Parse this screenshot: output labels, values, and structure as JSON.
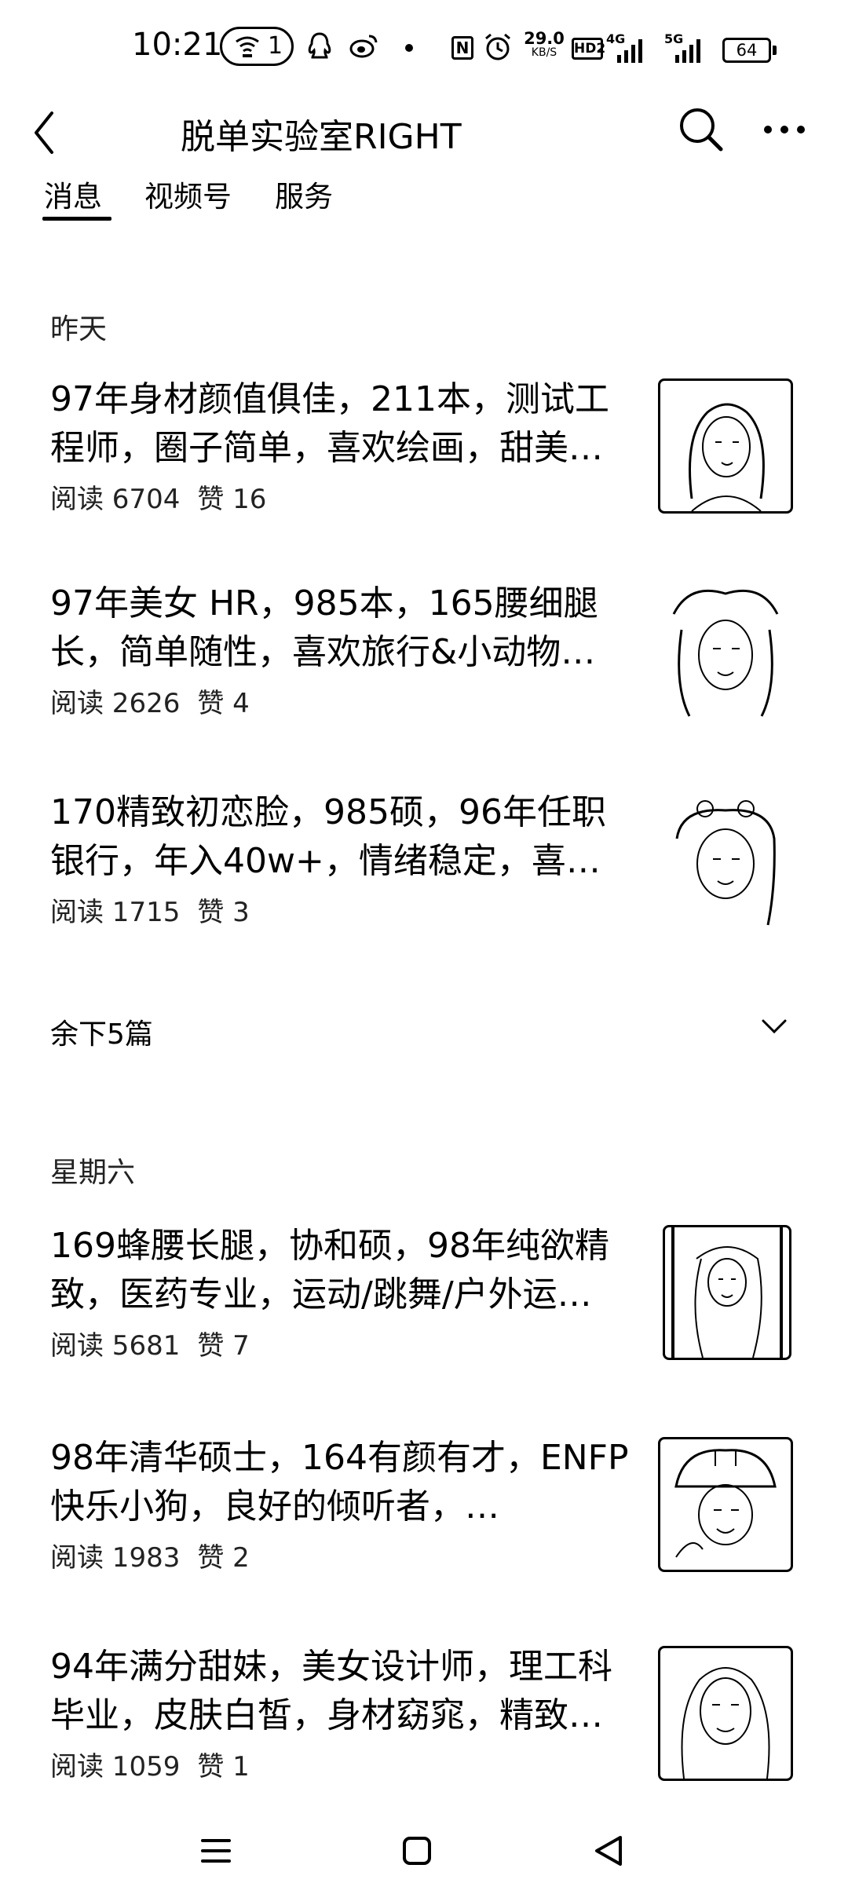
{
  "status_bar": {
    "time": "10:21",
    "pill_number": "1",
    "net_speed_value": "29.0",
    "net_speed_unit": "KB/S",
    "hd_label": "HD2",
    "signal1_label": "4G",
    "signal2_label": "5G",
    "battery": "64",
    "icons": [
      "wifi-hotspot-icon",
      "qq-icon",
      "weibo-icon",
      "nfc-icon",
      "alarm-icon",
      "hd-icon",
      "signal-icon",
      "battery-icon"
    ]
  },
  "header": {
    "title": "脱单实验室RIGHT",
    "back_icon": "chevron-left-icon",
    "search_icon": "search-icon",
    "more_icon": "more-horizontal-icon"
  },
  "tabs": [
    {
      "label": "消息",
      "active": true
    },
    {
      "label": "视频号",
      "active": false
    },
    {
      "label": "服务",
      "active": false
    }
  ],
  "sections": [
    {
      "date": "昨天",
      "articles": [
        {
          "title": "97年身材颜值俱佳，211本，测试工程师，圈子简单，喜欢绘画，甜美…",
          "reads": "阅读 6704",
          "likes": "赞 16"
        },
        {
          "title": "97年美女 HR，985本，165腰细腿长，简单随性，喜欢旅行&小动物…",
          "reads": "阅读 2626",
          "likes": "赞 4"
        },
        {
          "title": "170精致初恋脸，985硕，96年任职银行，年入40w+，情绪稳定，喜…",
          "reads": "阅读 1715",
          "likes": "赞 3"
        }
      ],
      "more_label": "余下5篇"
    },
    {
      "date": "星期六",
      "articles": [
        {
          "title": "169蜂腰长腿，协和硕，98年纯欲精致，医药专业，运动/跳舞/户外运…",
          "reads": "阅读 5681",
          "likes": "赞 7"
        },
        {
          "title": "98年清华硕士，164有颜有才，ENFP快乐小狗，良好的倾听者，…",
          "reads": "阅读 1983",
          "likes": "赞 2"
        },
        {
          "title": "94年满分甜妹，美女设计师，理工科毕业，皮肤白皙，身材窈窕，精致…",
          "reads": "阅读 1059",
          "likes": "赞 1"
        }
      ]
    }
  ],
  "nav_bar": {
    "icons": [
      "menu-icon",
      "home-square-icon",
      "back-triangle-icon"
    ]
  }
}
